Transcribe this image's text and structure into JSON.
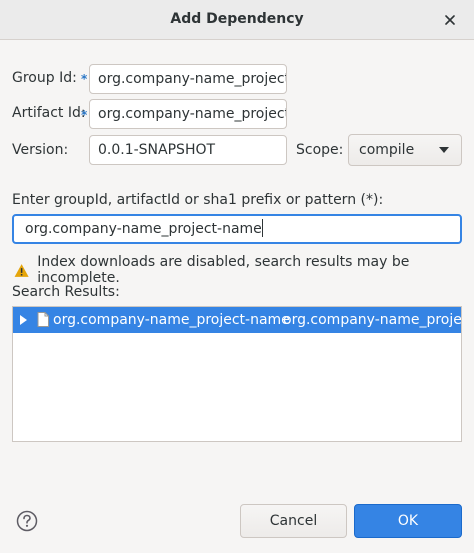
{
  "dialog": {
    "title": "Add Dependency"
  },
  "form": {
    "group_id_label": "Group Id:",
    "group_id_value": "org.company-name_project",
    "artifact_id_label": "Artifact Id:",
    "artifact_id_value": "org.company-name_project",
    "required_marker": "*",
    "version_label": "Version:",
    "version_value": "0.0.1-SNAPSHOT",
    "scope_label": "Scope:",
    "scope_value": "compile"
  },
  "search": {
    "prompt": "Enter groupId, artifactId or sha1 prefix or pattern (*):",
    "query": "org.company-name_project-name",
    "warning": "Index downloads are disabled, search results may be incomplete.",
    "results_label": "Search Results:",
    "results": [
      {
        "group": "org.company-name_project-name",
        "artifact": "org.company-name_project"
      }
    ]
  },
  "buttons": {
    "cancel": "Cancel",
    "ok": "OK"
  },
  "colors": {
    "accent": "#3584e4",
    "warning": "#e5a50a"
  },
  "icons": {
    "close": "close-icon",
    "warning": "warning-icon",
    "help": "help-icon",
    "dropdown": "chevron-down-icon",
    "expander": "expander-triangle-icon",
    "file": "file-icon"
  }
}
